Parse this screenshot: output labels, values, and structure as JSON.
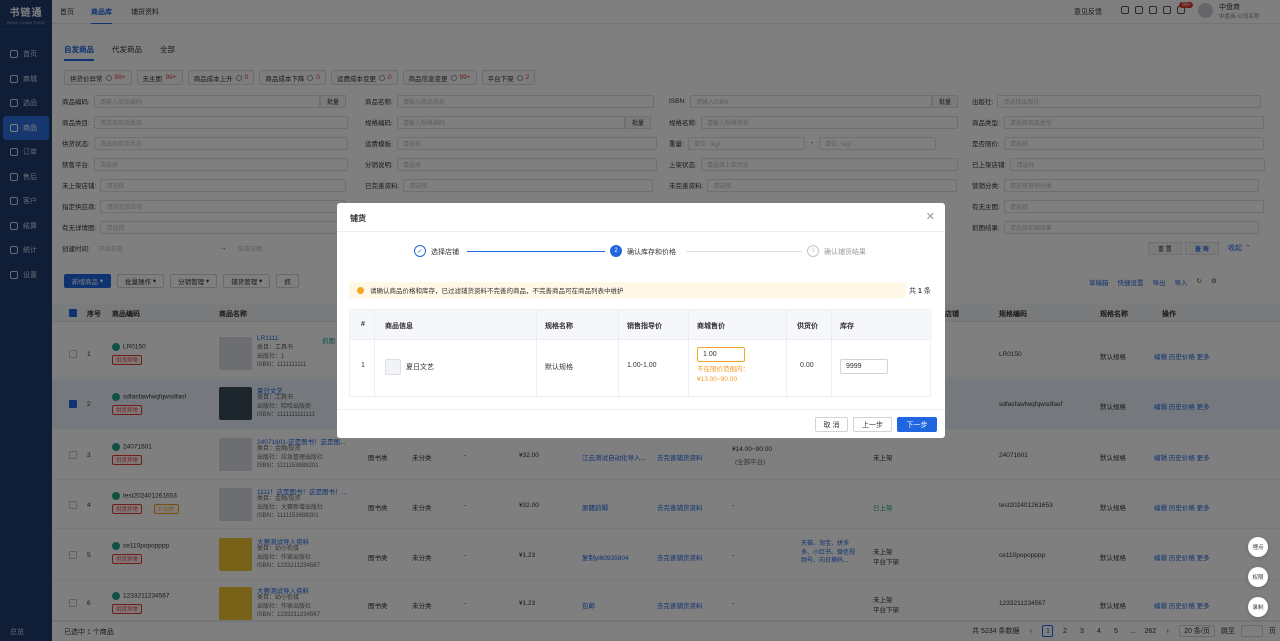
{
  "app": {
    "logo": "书链通",
    "logo_sub": "BOOK CHAIN TONG"
  },
  "sidebar": {
    "items": [
      {
        "label": "首页",
        "icon": "home-icon"
      },
      {
        "label": "商城",
        "icon": "mall-icon"
      },
      {
        "label": "选品",
        "icon": "select-icon"
      },
      {
        "label": "商品",
        "icon": "goods-icon"
      },
      {
        "label": "订单",
        "icon": "order-icon"
      },
      {
        "label": "售后",
        "icon": "aftersale-icon"
      },
      {
        "label": "客户",
        "icon": "customer-icon"
      },
      {
        "label": "结算",
        "icon": "settle-icon"
      },
      {
        "label": "统计",
        "icon": "stats-icon"
      },
      {
        "label": "设置",
        "icon": "settings-icon"
      }
    ],
    "bottom": "总览"
  },
  "topbar": {
    "tabs": [
      "首页",
      "商品库",
      "铺货资料"
    ],
    "feedback": "意见反馈",
    "badge": "99+",
    "user_name": "中盘商",
    "user_company": "中盘商-公司名称"
  },
  "subtabs": [
    "自发商品",
    "代发商品",
    "全部"
  ],
  "chips": [
    {
      "label": "供货价异常",
      "count": "99+"
    },
    {
      "label": "无主图",
      "count": "99+"
    },
    {
      "label": "商品成本上升",
      "count": "0"
    },
    {
      "label": "商品成本下降",
      "count": "0"
    },
    {
      "label": "运费成本变更",
      "count": "0"
    },
    {
      "label": "商品信息变更",
      "count": "99+"
    },
    {
      "label": "平台下架",
      "count": "2"
    }
  ],
  "filters": {
    "goods_code": "商品编码:",
    "goods_code_ph": "请输入商品编码",
    "batch": "批量",
    "goods_name": "商品名称:",
    "goods_name_ph": "请输入商品名称",
    "isbn": "ISBN:",
    "isbn_ph": "请输入ISBN",
    "publisher": "出版社:",
    "publisher_ph": "请选择出版社",
    "category": "商品类目:",
    "category_ph": "请选择商品类目",
    "spec_code": "规格编码:",
    "spec_code_ph": "请输入规格编码",
    "spec_name": "规格名称:",
    "spec_name_ph": "请输入规格名称",
    "goods_type": "商品类型:",
    "goods_type_ph": "请选择商品类型",
    "supply_status": "供货状态:",
    "supply_status_ph": "请选择供货状态",
    "freight": "运费模板:",
    "select_ph": "请选择",
    "weight": "重量:",
    "weight_ph": "单位（kg）",
    "limit_price": "是否限价:",
    "forbid_platform": "禁售平台:",
    "category_desc": "分销说明:",
    "shelf_status": "上架状态:",
    "shelf_status_ph": "请选择上架状态",
    "shelf_store": "已上架店铺:",
    "not_shelf_store": "未上架店铺:",
    "complete_info": "已完善资料:",
    "incomplete_info": "未完善资料:",
    "marketing": "营销分类:",
    "marketing_ph": "请选择营销分类",
    "supplier": "指定供应商:",
    "supplier_ph": "请指定供应商",
    "main_img": "有无主图:",
    "detail_img": "有无详情图:",
    "grab_result": "抓图结果:",
    "grab_result_ph": "请选择抓图结果",
    "created": "创建时间:",
    "start_ph": "开始日期",
    "end_ph": "结束日期",
    "reset": "重 置",
    "search": "查 询",
    "collapse": "收起"
  },
  "actions": {
    "add": "新增商品",
    "batch": "批量操作",
    "distribute": "分销管理",
    "shelf": "铺货管理",
    "grab": "抓",
    "drafts": "草稿箱",
    "quick_settings": "快捷设置",
    "export": "导出",
    "import": "导入"
  },
  "table": {
    "headers": {
      "index": "序号",
      "code": "商品编码",
      "name": "商品名称",
      "store": "店铺",
      "spec_code": "规格编码",
      "spec_name": "规格名称",
      "ops": "操作"
    },
    "rows": [
      {
        "idx": "1",
        "code": "LR0150",
        "tags": [
          "供货异常"
        ],
        "name": "LR1111",
        "cat": "类目：工具书",
        "pub": "出版社：1",
        "isbn": "ISBN：1111111111",
        "spec_code": "LR0150",
        "spec_name": "默认规格",
        "grab": "抓图"
      },
      {
        "idx": "2",
        "code": "sdfasfawfwqfqwsdfasf",
        "tags": [
          "供货异常"
        ],
        "name": "夏日文艺",
        "cat": "类目：工具书",
        "pub": "出版社：哈哈出版商",
        "isbn": "ISBN：1111111111111",
        "spec_code": "sdfasfawfwqfqwsdfasf",
        "spec_name": "默认规格"
      },
      {
        "idx": "3",
        "code": "24071601",
        "tags": [
          "供货异常"
        ],
        "name": "24071601-这是图书！这是图...",
        "cat": "类目：金融/投资",
        "pub": "出版社：应急管理出版社",
        "isbn": "ISBN：1111153888201",
        "type": "图书类",
        "cls": "未分类",
        "dash": "-",
        "price": "¥32.00",
        "dist": "江云测试自动化导入...",
        "todo": "去完善铺货资料",
        "range": "¥14.00~90.00",
        "range2": "(全部平台)",
        "status": "未上架",
        "spec_code": "24071601",
        "spec_name": "默认规格"
      },
      {
        "idx": "4",
        "code": "test202401261653",
        "tags": [
          "供货异常",
          "7-10岁"
        ],
        "name": "1111！这是图书！这是图书！...",
        "cat": "类目：金融/投资",
        "pub": "出版社：大赛新增出版社",
        "isbn": "ISBN：1111153888201",
        "type": "图书类",
        "cls": "未分类",
        "dash": "-",
        "price": "¥32.00",
        "dist": "原藉韵脚",
        "todo": "去完善铺货资料",
        "range": "-",
        "status": "已上架",
        "spec_code": "test202401261653",
        "spec_name": "默认规格"
      },
      {
        "idx": "5",
        "code": "ce110popopppp",
        "tags": [
          "供货异常"
        ],
        "name": "大赛测试导入资料",
        "cat": "类目：幼小衔接",
        "pub": "出版社：作家出版社",
        "isbn": "ISBN：1233211234567",
        "type": "图书类",
        "cls": "未分类",
        "dash": "-",
        "price": "¥1.23",
        "dist": "复制yl60935904",
        "todo": "去完善铺货资料",
        "range": "-",
        "platforms": [
          "天猫、淘宝、拼多",
          "多、小红书、微信视",
          "频号、向日葵码..."
        ],
        "status": "未上架",
        "status2": "平台下架",
        "spec_code": "ce110popopppp",
        "spec_name": "默认规格"
      },
      {
        "idx": "6",
        "code": "1233211234567",
        "tags": [
          "供货异常"
        ],
        "name": "大赛测试导入资料",
        "cat": "类目：幼小衔接",
        "pub": "出版社：作家出版社",
        "isbn": "ISBN：1233211234567",
        "type": "图书类",
        "cls": "未分类",
        "dash": "-",
        "price": "¥1.23",
        "dist": "包邮",
        "todo": "去完善铺货资料",
        "range": "-",
        "status": "未上架",
        "status2": "平台下架",
        "spec_code": "1233211234567",
        "spec_name": "默认规格"
      }
    ],
    "ops": {
      "edit": "编辑",
      "history": "历史价格",
      "more": "更多"
    }
  },
  "footer": {
    "sel_prefix": "已选中",
    "sel_count": "1",
    "sel_suffix": "个商品",
    "total": "共 5234 条数据",
    "pages": [
      "1",
      "2",
      "3",
      "4",
      "5",
      "...",
      "262"
    ],
    "page_size": "20 条/页",
    "goto": "跳至",
    "page_unit": "页"
  },
  "floaters": [
    "埋点",
    "权限",
    "录制"
  ],
  "modal": {
    "title": "铺货",
    "steps": [
      "选择店铺",
      "确认库存和价格",
      "确认铺货结果"
    ],
    "step2_num": "2",
    "step3_num": "3",
    "notice": "请确认商品价格和库存，已过滤铺货资料不完善的商品，不完善商品可在商品列表中维护",
    "total_prefix": "共",
    "total_num": "1",
    "total_suffix": "条",
    "headers": [
      "#",
      "商品信息",
      "规格名称",
      "销售指导价",
      "商城售价",
      "供货价",
      "库存"
    ],
    "row": {
      "idx": "1",
      "name": "夏日文艺",
      "spec": "默认规格",
      "guide": "1.00-1.00",
      "price": "1.00",
      "err1": "不在限价范围内：",
      "err2": "¥13.00~90.00",
      "supply": "0.00",
      "stock": "9999"
    },
    "buttons": {
      "cancel": "取 消",
      "prev": "上一步",
      "next": "下一步"
    }
  }
}
